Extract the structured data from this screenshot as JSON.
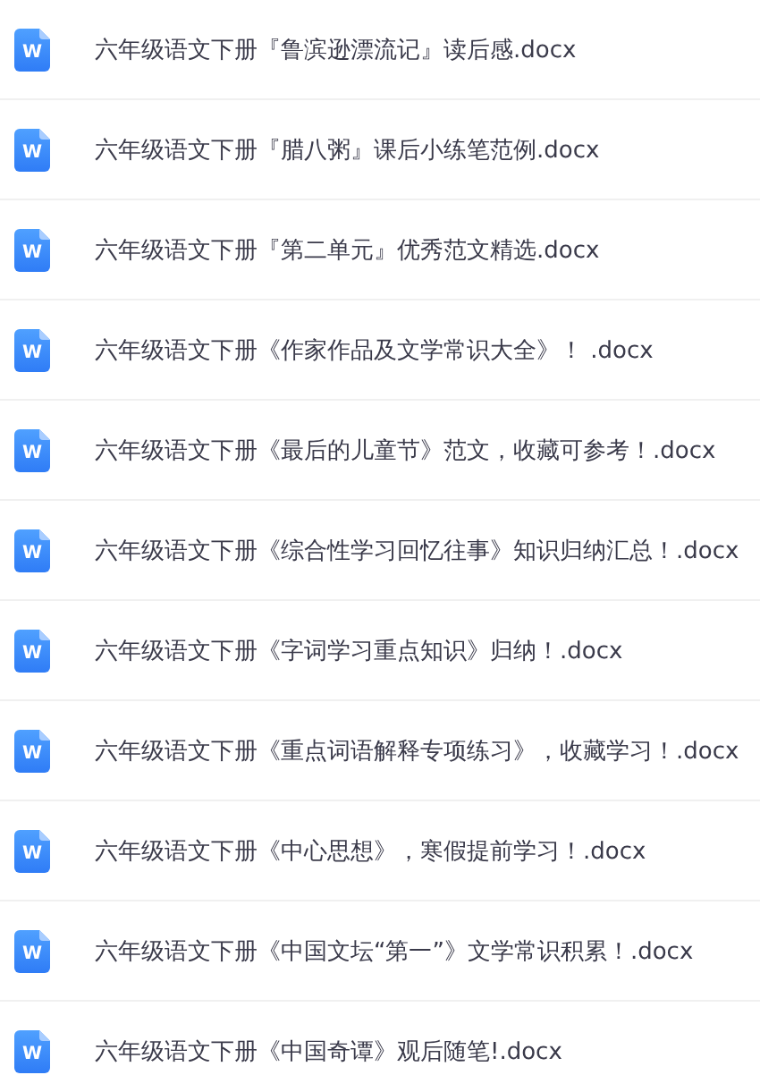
{
  "files": [
    {
      "icon_letter": "W",
      "name": "六年级语文下册『鲁滨逊漂流记』读后感.docx"
    },
    {
      "icon_letter": "W",
      "name": "六年级语文下册『腊八粥』课后小练笔范例.docx"
    },
    {
      "icon_letter": "W",
      "name": "六年级语文下册『第二单元』优秀范文精选.docx"
    },
    {
      "icon_letter": "W",
      "name": "六年级语文下册《作家作品及文学常识大全》！ .docx"
    },
    {
      "icon_letter": "W",
      "name": "六年级语文下册《最后的儿童节》范文，收藏可参考！.docx"
    },
    {
      "icon_letter": "W",
      "name": "六年级语文下册《综合性学习回忆往事》知识归纳汇总！.docx"
    },
    {
      "icon_letter": "W",
      "name": "六年级语文下册《字词学习重点知识》归纳！.docx"
    },
    {
      "icon_letter": "W",
      "name": "六年级语文下册《重点词语解释专项练习》，收藏学习！.docx"
    },
    {
      "icon_letter": "W",
      "name": "六年级语文下册《中心思想》，寒假提前学习！.docx"
    },
    {
      "icon_letter": "W",
      "name": "六年级语文下册《中国文坛“第一”》文学常识积累！.docx"
    },
    {
      "icon_letter": "W",
      "name": "六年级语文下册《中国奇谭》观后随笔!.docx"
    }
  ]
}
